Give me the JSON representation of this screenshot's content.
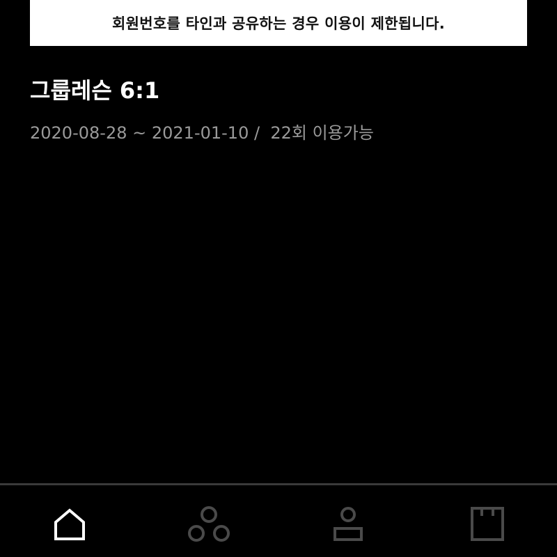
{
  "notice": {
    "text": "회원번호를 타인과 공유하는 경우 이용이 제한됩니다."
  },
  "ticket": {
    "title": "그룹레슨 6:1",
    "start_date": "2020-08-28",
    "separator": " ~ ",
    "end_date": "2021-01-10",
    "slash": " /  ",
    "remaining": "22회 이용가능"
  },
  "bottom_nav": {
    "items": [
      {
        "icon": "home-icon",
        "active": true
      },
      {
        "icon": "group-icon",
        "active": false
      },
      {
        "icon": "profile-icon",
        "active": false
      },
      {
        "icon": "store-icon",
        "active": false
      }
    ]
  },
  "colors": {
    "background": "#000000",
    "notice_bg": "#ffffff",
    "title": "#ffffff",
    "info": "#9a9a9a",
    "nav_active": "#ffffff",
    "nav_inactive": "#4a4a4a",
    "divider": "#3a3a3a"
  }
}
